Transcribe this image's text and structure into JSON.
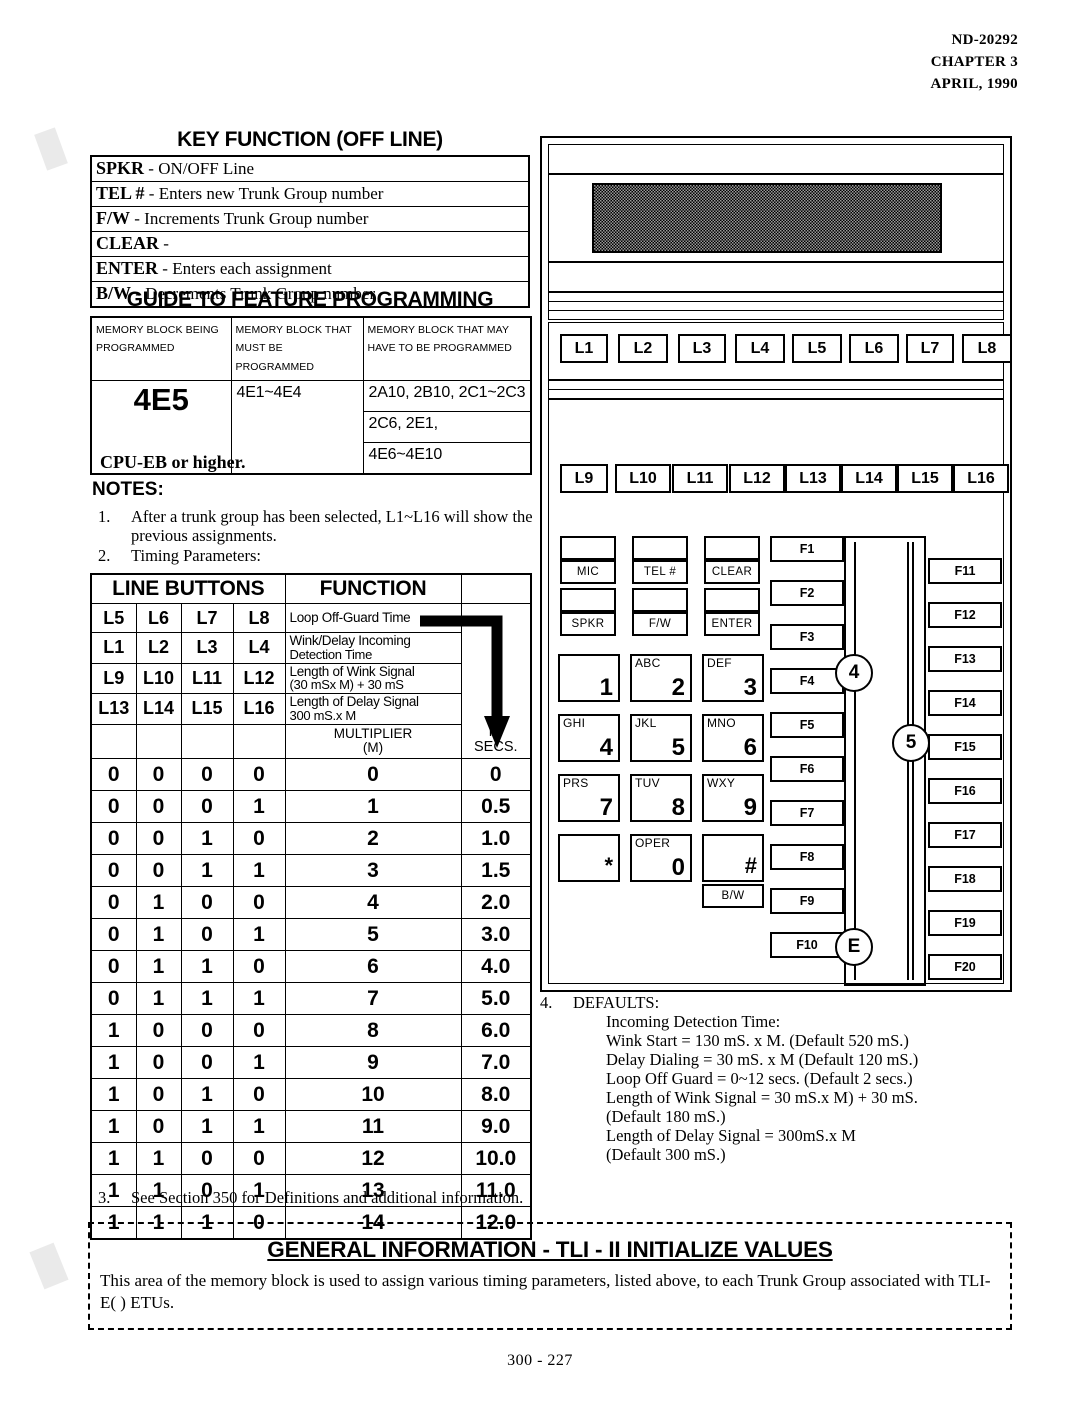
{
  "header": {
    "doc_number": "ND-20292",
    "chapter": "CHAPTER 3",
    "date": "APRIL, 1990"
  },
  "key_function": {
    "title": "KEY FUNCTION (OFF LINE)",
    "rows": [
      {
        "key": "SPKR",
        "sep": "-",
        "desc": "ON/OFF Line"
      },
      {
        "key": "TEL #",
        "sep": "-",
        "desc": "Enters new Trunk Group number"
      },
      {
        "key": "F/W",
        "sep": "-",
        "desc": "Increments  Trunk Group number"
      },
      {
        "key": "CLEAR",
        "sep": "-",
        "desc": ""
      },
      {
        "key": "ENTER",
        "sep": "-",
        "desc": "Enters each assignment"
      },
      {
        "key": "B/W",
        "sep": "-",
        "desc": "Decrements Trunk Group number"
      }
    ]
  },
  "guide": {
    "title": "GUIDE TO FEATURE PROGRAMMING",
    "headers": [
      "MEMORY BLOCK BEING\nPROGRAMMED",
      "MEMORY BLOCK THAT\nMUST BE PROGRAMMED",
      "MEMORY BLOCK THAT MAY\nHAVE TO BE PROGRAMMED"
    ],
    "header_line1": [
      "MEMORY BLOCK BEING",
      "MEMORY BLOCK THAT",
      "MEMORY BLOCK THAT MAY"
    ],
    "header_line2": [
      "PROGRAMMED",
      "MUST BE PROGRAMMED",
      "HAVE TO BE PROGRAMMED"
    ],
    "block": "4E5",
    "must": [
      "4E1~4E4",
      "",
      ""
    ],
    "may": [
      "2A10, 2B10, 2C1~2C3",
      "2C6, 2E1,",
      "4E6~4E10"
    ]
  },
  "cpu_note": "CPU-EB or higher.",
  "notes": {
    "title": "NOTES:",
    "items": [
      {
        "num": "1.",
        "text": "After a trunk group has been selected, L1~L16 will show the previous  assignments."
      },
      {
        "num": "2.",
        "text": "Timing Parameters:"
      },
      {
        "num": "3.",
        "text": "See Section 350 for Definitions and additional information."
      }
    ]
  },
  "timing_table": {
    "head_left": "LINE BUTTONS",
    "head_right": "FUNCTION",
    "in_secs": "IN\nSECS.",
    "in_secs_l1": "IN",
    "in_secs_l2": "SECS.",
    "function_rows": [
      {
        "buttons": [
          "L5",
          "L6",
          "L7",
          "L8"
        ],
        "function_l1": "Loop Off-Guard Time",
        "function_l2": ""
      },
      {
        "buttons": [
          "L1",
          "L2",
          "L3",
          "L4"
        ],
        "function_l1": "Wink/Delay Incoming",
        "function_l2": "Detection Time"
      },
      {
        "buttons": [
          "L9",
          "L10",
          "L11",
          "L12"
        ],
        "function_l1": "Length of Wink Signal",
        "function_l2": "(30 mSx M) + 30 mS"
      },
      {
        "buttons": [
          "L13",
          "L14",
          "L15",
          "L16"
        ],
        "function_l1": "Length of Delay Signal",
        "function_l2": "300 mS.x M"
      }
    ],
    "multiplier_l1": "MULTIPLIER",
    "multiplier_l2": "(M)",
    "data_rows": [
      {
        "bits": [
          "0",
          "0",
          "0",
          "0"
        ],
        "m": "0",
        "secs": "0"
      },
      {
        "bits": [
          "0",
          "0",
          "0",
          "1"
        ],
        "m": "1",
        "secs": "0.5"
      },
      {
        "bits": [
          "0",
          "0",
          "1",
          "0"
        ],
        "m": "2",
        "secs": "1.0"
      },
      {
        "bits": [
          "0",
          "0",
          "1",
          "1"
        ],
        "m": "3",
        "secs": "1.5"
      },
      {
        "bits": [
          "0",
          "1",
          "0",
          "0"
        ],
        "m": "4",
        "secs": "2.0"
      },
      {
        "bits": [
          "0",
          "1",
          "0",
          "1"
        ],
        "m": "5",
        "secs": "3.0"
      },
      {
        "bits": [
          "0",
          "1",
          "1",
          "0"
        ],
        "m": "6",
        "secs": "4.0"
      },
      {
        "bits": [
          "0",
          "1",
          "1",
          "1"
        ],
        "m": "7",
        "secs": "5.0"
      },
      {
        "bits": [
          "1",
          "0",
          "0",
          "0"
        ],
        "m": "8",
        "secs": "6.0"
      },
      {
        "bits": [
          "1",
          "0",
          "0",
          "1"
        ],
        "m": "9",
        "secs": "7.0"
      },
      {
        "bits": [
          "1",
          "0",
          "1",
          "0"
        ],
        "m": "10",
        "secs": "8.0"
      },
      {
        "bits": [
          "1",
          "0",
          "1",
          "1"
        ],
        "m": "11",
        "secs": "9.0"
      },
      {
        "bits": [
          "1",
          "1",
          "0",
          "0"
        ],
        "m": "12",
        "secs": "10.0"
      },
      {
        "bits": [
          "1",
          "1",
          "0",
          "1"
        ],
        "m": "13",
        "secs": "11.0"
      },
      {
        "bits": [
          "1",
          "1",
          "1",
          "0"
        ],
        "m": "14",
        "secs": "12.0"
      }
    ]
  },
  "defaults": {
    "num": "4.",
    "title": "DEFAULTS:",
    "lines": [
      "Incoming Detection Time:",
      "Wink Start = 130 mS. x M. (Default 520 mS.)",
      "Delay Dialing = 30 mS. x M (Default 120 mS.)",
      "Loop Off Guard = 0~12 secs. (Default 2 secs.)",
      "Length of Wink Signal = 30 mS.x M) + 30 mS.",
      "(Default 180 mS.)",
      "Length of Delay Signal = 300mS.x M",
      "(Default 300 mS.)"
    ]
  },
  "phone": {
    "line_buttons_row1": [
      "L1",
      "L2",
      "L3",
      "L4",
      "L5",
      "L6",
      "L7",
      "L8"
    ],
    "line_buttons_row2": [
      "L9",
      "L10",
      "L11",
      "L12",
      "L13",
      "L14",
      "L15",
      "L16"
    ],
    "feature_keys": [
      "MIC",
      "TEL #",
      "CLEAR",
      "SPKR",
      "F/W",
      "ENTER"
    ],
    "bw_key": "B/W",
    "dial_keys": [
      {
        "letters": "",
        "digit": "1"
      },
      {
        "letters": "ABC",
        "digit": "2"
      },
      {
        "letters": "DEF",
        "digit": "3"
      },
      {
        "letters": "GHI",
        "digit": "4"
      },
      {
        "letters": "JKL",
        "digit": "5"
      },
      {
        "letters": "MNO",
        "digit": "6"
      },
      {
        "letters": "PRS",
        "digit": "7"
      },
      {
        "letters": "TUV",
        "digit": "8"
      },
      {
        "letters": "WXY",
        "digit": "9"
      },
      {
        "letters": "",
        "digit": "*"
      },
      {
        "letters": "OPER",
        "digit": "0"
      },
      {
        "letters": "",
        "digit": "#"
      }
    ],
    "f_keys_left": [
      "F1",
      "F2",
      "F3",
      "F4",
      "F5",
      "F6",
      "F7",
      "F8",
      "F9",
      "F10"
    ],
    "f_keys_right": [
      "F11",
      "F12",
      "F13",
      "F14",
      "F15",
      "F16",
      "F17",
      "F18",
      "F19",
      "F20"
    ],
    "callouts": [
      "4",
      "5",
      "E"
    ]
  },
  "general_info": {
    "title": "GENERAL INFORMATION  -  TLI - II  INITIALIZE  VALUES",
    "body": "This area of the memory block is used to assign various timing parameters, listed above, to each Trunk Group associated with TLI-E( ) ETUs."
  },
  "footer": "300 - 227"
}
